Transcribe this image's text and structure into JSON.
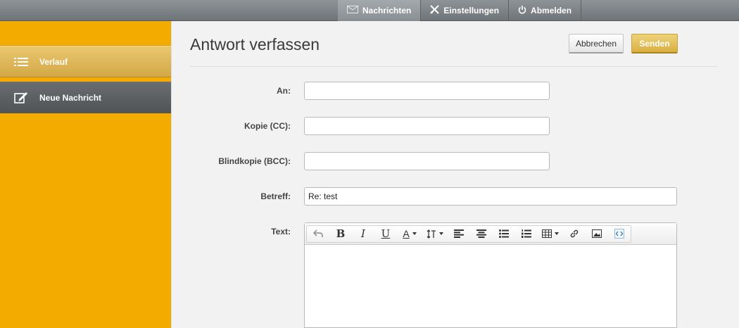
{
  "topnav": {
    "items": [
      {
        "label": "Nachrichten",
        "icon": "envelope-icon",
        "active": true
      },
      {
        "label": "Einstellungen",
        "icon": "tools-icon"
      },
      {
        "label": "Abmelden",
        "icon": "power-icon"
      }
    ]
  },
  "sidebar": {
    "items": [
      {
        "label": "Verlauf",
        "icon": "list-icon",
        "active": true
      },
      {
        "label": "Neue Nachricht",
        "icon": "compose-icon"
      }
    ]
  },
  "main": {
    "title": "Antwort verfassen",
    "buttons": {
      "cancel": "Abbrechen",
      "send": "Senden"
    },
    "form": {
      "to_label": "An:",
      "to_value": "",
      "cc_label": "Kopie (CC):",
      "cc_value": "",
      "bcc_label": "Blindkopie (BCC):",
      "bcc_value": "",
      "subject_label": "Betreff:",
      "subject_value": "Re: test",
      "text_label": "Text:"
    },
    "editor": {
      "toolbar_icons": [
        "undo-icon",
        "bold-icon",
        "italic-icon",
        "underline-icon",
        "font-color-icon",
        "font-size-icon",
        "align-left-icon",
        "align-center-icon",
        "bullet-list-icon",
        "numbered-list-icon",
        "table-icon",
        "link-icon",
        "image-icon",
        "source-code-icon"
      ],
      "bold_glyph": "B",
      "italic_glyph": "I",
      "underline_glyph": "U",
      "font_color_glyph": "A",
      "content": ""
    }
  },
  "colors": {
    "sidebar": "#f3ab00",
    "topbar": "#7d8286",
    "send_button": "#e2bf55",
    "active_sidebar": "#dfb85c"
  }
}
